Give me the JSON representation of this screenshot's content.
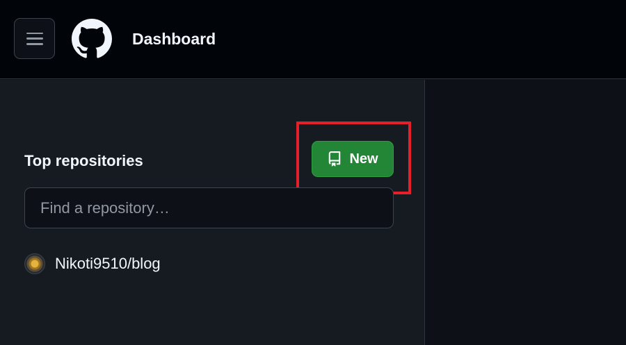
{
  "header": {
    "menu_icon": "hamburger-menu-icon",
    "logo_icon": "github-mark-icon",
    "title": "Dashboard"
  },
  "sidebar": {
    "section_title": "Top repositories",
    "new_button": {
      "label": "New",
      "icon": "repo-icon"
    },
    "search": {
      "placeholder": "Find a repository…",
      "value": ""
    },
    "repositories": [
      {
        "name": "Nikoti9510/blog",
        "icon": "avatar"
      }
    ]
  },
  "colors": {
    "header_bg": "#010409",
    "sidebar_bg": "#161b22",
    "main_bg": "#0d1117",
    "primary_button": "#238636",
    "highlight_outline": "#e5202a"
  }
}
